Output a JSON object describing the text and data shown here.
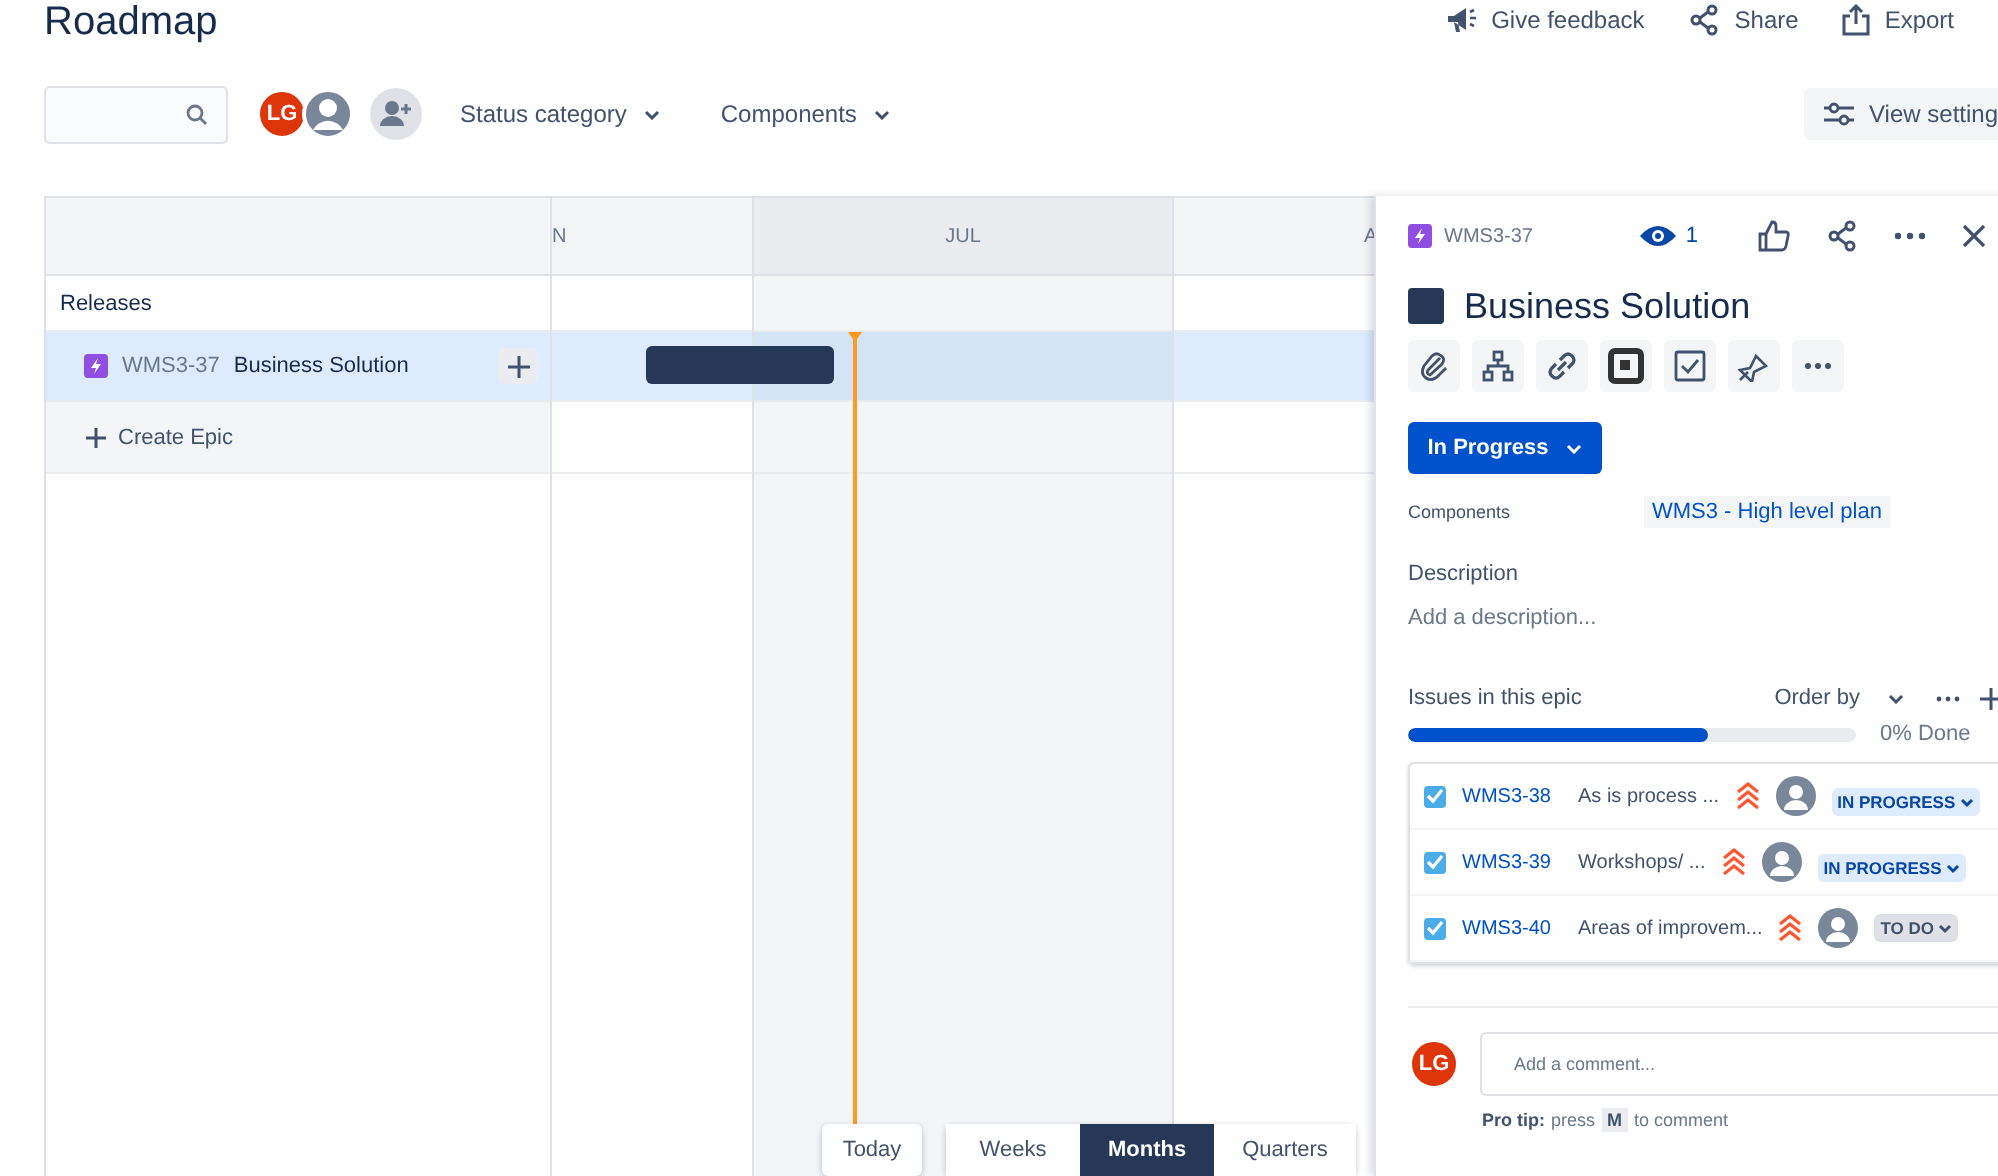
{
  "page": {
    "title": "Roadmap"
  },
  "header_actions": [
    {
      "kind": "feedback",
      "label": "Give feedback"
    },
    {
      "kind": "share",
      "label": "Share"
    },
    {
      "kind": "export",
      "label": "Export"
    }
  ],
  "toolbar": {
    "avatars": [
      {
        "kind": "initials",
        "initials": "LG"
      },
      {
        "kind": "silhouette"
      }
    ],
    "filters": [
      "Status category",
      "Components"
    ],
    "view_settings": "View setting"
  },
  "timeline": {
    "months": [
      {
        "label": "N",
        "shaded": false
      },
      {
        "label": "JUL",
        "shaded": true
      },
      {
        "label": "A",
        "shaded": false
      }
    ],
    "releases_label": "Releases",
    "epics": [
      {
        "key": "WMS3-37",
        "title": "Business Solution",
        "selected": true
      }
    ],
    "create_label": "Create Epic"
  },
  "zoom": {
    "today": "Today",
    "scales": [
      {
        "label": "Weeks",
        "selected": false
      },
      {
        "label": "Months",
        "selected": true
      },
      {
        "label": "Quarters",
        "selected": false
      }
    ]
  },
  "panel": {
    "key": "WMS3-37",
    "watchers": "1",
    "title": "Business Solution",
    "status": "In Progress",
    "components_label": "Components",
    "component": "WMS3 - High level plan",
    "description_label": "Description",
    "description_placeholder": "Add a description...",
    "issues_heading": "Issues in this epic",
    "order_by": "Order by",
    "progress": {
      "level": 0.67
    },
    "done": "0% Done",
    "issues": [
      {
        "checked": true,
        "key": "WMS3-38",
        "summary": "As is process ...",
        "status": "IN PROGRESS",
        "kind": "progress"
      },
      {
        "checked": true,
        "key": "WMS3-39",
        "summary": "Workshops/ ...",
        "status": "IN PROGRESS",
        "kind": "progress"
      },
      {
        "checked": true,
        "key": "WMS3-40",
        "summary": "Areas of improvem...",
        "status": "TO DO",
        "kind": "todo"
      }
    ],
    "comment_avatar": "LG",
    "comment_placeholder": "Add a comment...",
    "tip_label": "Pro tip:",
    "tip_before": "press",
    "tip_key": "M",
    "tip_after": "to comment"
  }
}
